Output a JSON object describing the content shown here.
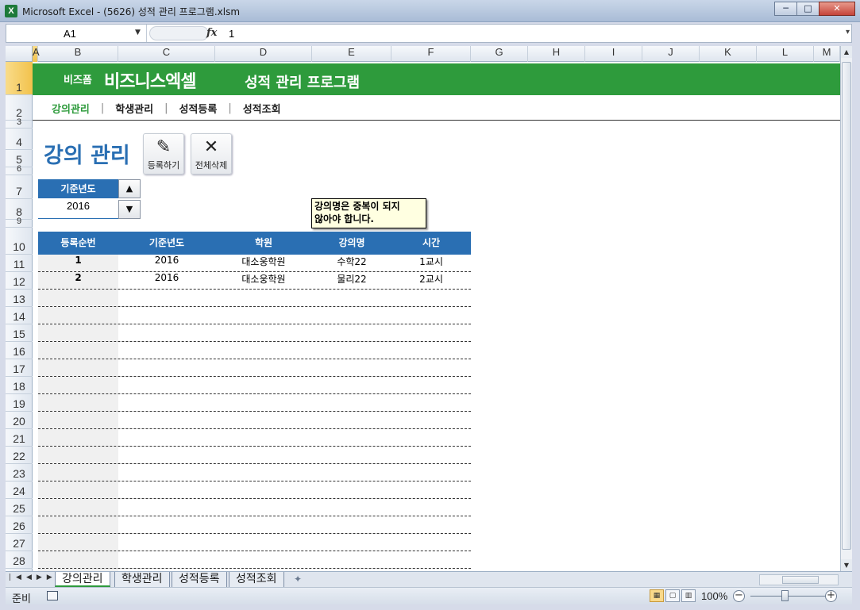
{
  "window": {
    "title": "Microsoft Excel - (5626) 성적 관리 프로그램.xlsm",
    "app_icon": "X",
    "controls": [
      "─",
      "□",
      "✕"
    ]
  },
  "formula_bar": {
    "name_box": "A1",
    "fx_label": "fx",
    "value": "1"
  },
  "columns": [
    {
      "label": "A",
      "selected": true
    },
    {
      "label": "B"
    },
    {
      "label": "C"
    },
    {
      "label": "D"
    },
    {
      "label": "E"
    },
    {
      "label": "F"
    },
    {
      "label": "G"
    },
    {
      "label": "H"
    },
    {
      "label": "I"
    },
    {
      "label": "J"
    },
    {
      "label": "K"
    },
    {
      "label": "L"
    },
    {
      "label": "M"
    }
  ],
  "rows": [
    "1",
    "2",
    "3",
    "4",
    "5",
    "6",
    "7",
    "8",
    "9",
    "10",
    "11",
    "12",
    "13",
    "14",
    "15",
    "16",
    "17",
    "18",
    "19",
    "20",
    "21",
    "22",
    "23",
    "24",
    "25",
    "26",
    "27",
    "28"
  ],
  "banner": {
    "brand_small": "비즈폼",
    "brand_big": "비즈니스엑셀",
    "title": "성적 관리 프로그램",
    "color": "#2e9b3c"
  },
  "menu": {
    "items": [
      "강의관리",
      "학생관리",
      "성적등록",
      "성적조회"
    ],
    "active_index": 0,
    "separator": "|"
  },
  "page": {
    "title": "강의 관리",
    "register_button": "등록하기",
    "register_icon": "pencil-icon",
    "delete_all_button": "전체삭제",
    "delete_icon": "close-icon"
  },
  "year_filter": {
    "label": "기준년도",
    "value": "2016",
    "up": "▲",
    "down": "▼"
  },
  "comment": {
    "text_line1": "강의명은 중복이 되지",
    "text_line2": "않아야 합니다."
  },
  "table": {
    "headers": [
      "등록순번",
      "기준년도",
      "학원",
      "강의명",
      "시간"
    ],
    "rows": [
      [
        "1",
        "2016",
        "대소웅학원",
        "수학22",
        "1교시"
      ],
      [
        "2",
        "2016",
        "대소웅학원",
        "물리22",
        "2교시"
      ]
    ],
    "header_color": "#2a6fb3"
  },
  "sheet_tabs": [
    "강의관리",
    "학생관리",
    "성적등록",
    "성적조회"
  ],
  "status": {
    "ready": "준비",
    "zoom": "100%"
  }
}
